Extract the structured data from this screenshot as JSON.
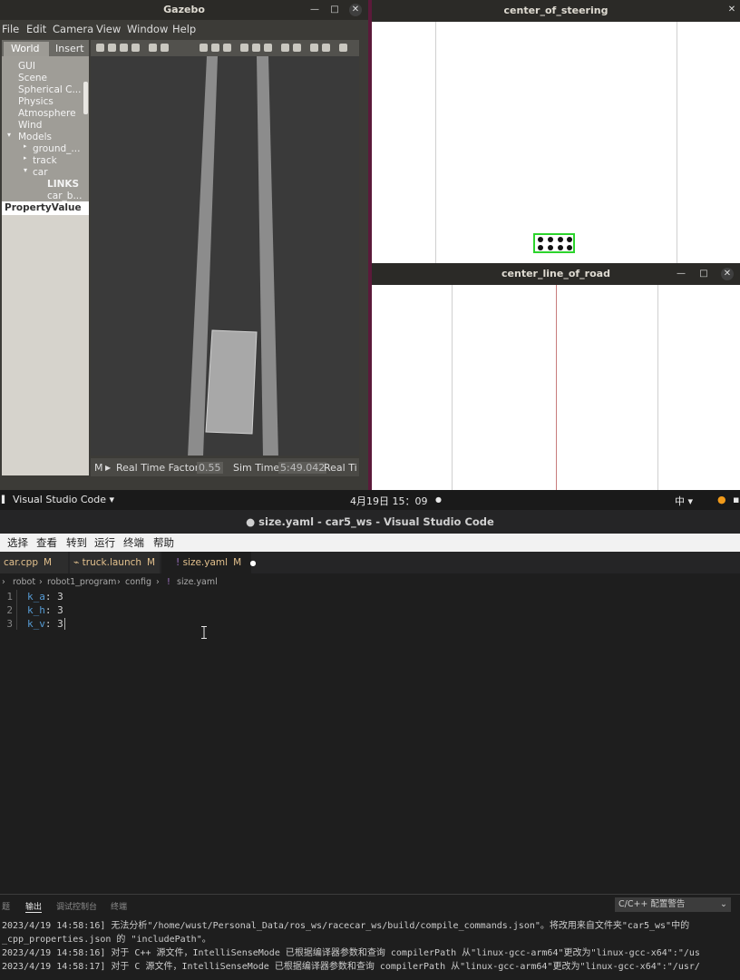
{
  "gazebo": {
    "title": "Gazebo",
    "menu": [
      "File",
      "Edit",
      "Camera",
      "View",
      "Window",
      "Help"
    ],
    "tabs": [
      "World",
      "Insert"
    ],
    "tree": [
      "GUI",
      "Scene",
      "Spherical C...",
      "Physics",
      "Atmosphere",
      "Wind",
      "Models",
      "ground_...",
      "track",
      "car",
      "LINKS",
      "car_b..."
    ],
    "property_header": "PropertyValue",
    "status": {
      "mode": "M",
      "rtf_label": "Real Time Factor:",
      "rtf_value": "0.55",
      "sim_label": "Sim Time:",
      "sim_value": "5:49.042",
      "real_label": "Real Ti"
    }
  },
  "windows": {
    "steering_title": "center_of_steering",
    "road_title": "center_line_of_road"
  },
  "topbar": {
    "app": "Visual Studio Code ▾",
    "datetime": "4月19日 15：09",
    "input_method": "中 ▾"
  },
  "vscode": {
    "title": "● size.yaml - car5_ws - Visual Studio Code",
    "menu": [
      "选择",
      "查看",
      "转到",
      "运行",
      "终端",
      "帮助"
    ],
    "tabs": [
      {
        "label": "car.cpp",
        "badge": "M"
      },
      {
        "label": "truck.launch",
        "badge": "M"
      },
      {
        "label": "size.yaml",
        "badge": "M"
      }
    ],
    "breadcrumb": [
      "robot",
      "robot1_program",
      "config",
      "size.yaml"
    ],
    "code": [
      {
        "n": "1",
        "key": "k_a",
        "val": "3"
      },
      {
        "n": "2",
        "key": "k_h",
        "val": "3"
      },
      {
        "n": "3",
        "key": "k_v",
        "val": "3"
      }
    ],
    "panel_tabs": [
      "题",
      "输出",
      "调试控制台",
      "终端"
    ],
    "panel_select": "C/C++ 配置警告",
    "output": [
      "2023/4/19 14:58:16] 无法分析\"/home/wust/Personal_Data/ros_ws/racecar_ws/build/compile_commands.json\"。将改用来自文件夹\"car5_ws\"中的",
      "_cpp_properties.json 的 \"includePath\"。",
      "2023/4/19 14:58:16] 对于 C++ 源文件，IntelliSenseMode 已根据编译器参数和查询 compilerPath 从\"linux-gcc-arm64\"更改为\"linux-gcc-x64\":\"/us",
      "2023/4/19 14:58:17] 对于 C 源文件，IntelliSenseMode 已根据编译器参数和查询 compilerPath 从\"linux-gcc-arm64\"更改为\"linux-gcc-x64\":\"/usr/"
    ]
  },
  "colors": {
    "steering_box": "#2cd42c",
    "road_center_line": "#c87c7c"
  }
}
